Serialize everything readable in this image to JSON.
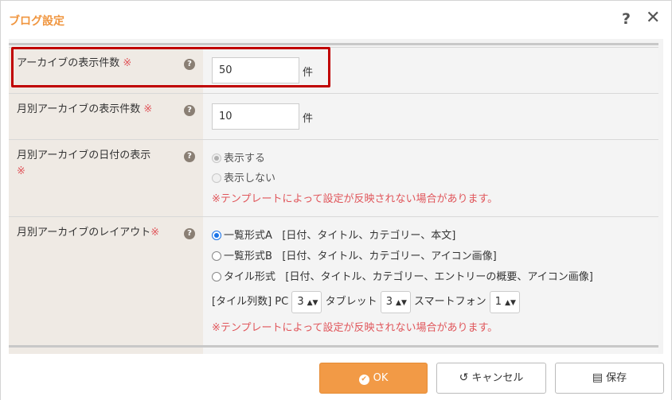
{
  "dialog": {
    "title": "ブログ設定",
    "help_icon": "?",
    "close_icon": "✕"
  },
  "rows": {
    "archive_count": {
      "label": "アーカイブの表示件数",
      "required_mark": "※",
      "value": "50",
      "unit": "件"
    },
    "monthly_count": {
      "label": "月別アーカイブの表示件数",
      "required_mark": "※",
      "value": "10",
      "unit": "件"
    },
    "monthly_date": {
      "label": "月別アーカイブの日付の表示",
      "required_mark": "※",
      "options": [
        "表示する",
        "表示しない"
      ],
      "note": "※テンプレートによって設定が反映されない場合があります。"
    },
    "monthly_layout": {
      "label": "月別アーカイブのレイアウト",
      "required_mark": "※",
      "options": [
        {
          "name": "一覧形式A",
          "detail": "[日付、タイトル、カテゴリー、本文]"
        },
        {
          "name": "一覧形式B",
          "detail": "[日付、タイトル、カテゴリー、アイコン画像]"
        },
        {
          "name": "タイル形式",
          "detail": "[日付、タイトル、カテゴリー、エントリーの概要、アイコン画像]"
        }
      ],
      "tile_columns_label": "[タイル列数] PC",
      "pc_value": "3",
      "tablet_label": "タブレット",
      "tablet_value": "3",
      "smartphone_label": "スマートフォン",
      "smartphone_value": "1",
      "note": "※テンプレートによって設定が反映されない場合があります。"
    }
  },
  "footer": {
    "ok_label": "OK",
    "cancel_label": "キャンセル",
    "save_label": "保存"
  },
  "colors": {
    "accent": "#f29a46",
    "required": "#e0555a",
    "highlight": "#c00000"
  }
}
